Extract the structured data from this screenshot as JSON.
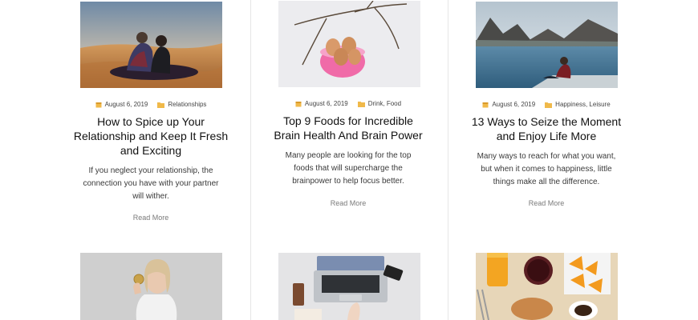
{
  "posts": [
    {
      "date": "August 6, 2019",
      "category": "Relationships",
      "title_lines": [
        "How to Spice up Your",
        "Relationship and Keep It Fresh",
        "and Exciting"
      ],
      "excerpt_lines": [
        "If you neglect your relationship, the",
        "connection you have with your partner",
        "will wither."
      ],
      "read_more": "Read More"
    },
    {
      "date": "August 6, 2019",
      "category": "Drink, Food",
      "title_lines": [
        "Top 9 Foods for Incredible",
        "Brain Health And Brain Power"
      ],
      "excerpt_lines": [
        "Many people are looking for the top",
        "foods that will supercharge the",
        "brainpower to help focus better."
      ],
      "read_more": "Read More"
    },
    {
      "date": "August 6, 2019",
      "category": "Happiness, Leisure",
      "title_lines": [
        "13 Ways to Seize the Moment",
        "and Enjoy Life More"
      ],
      "excerpt_lines": [
        "Many ways to reach for what you want,",
        "but when it comes to happiness, little",
        "things make all the difference."
      ],
      "read_more": "Read More"
    }
  ],
  "icons": {
    "date": "calendar-icon",
    "category": "folder-icon"
  },
  "colors": {
    "icon_accent": "#f0b94a",
    "title": "#111111",
    "excerpt": "#3a3a3a",
    "read_more": "#7a7a7a",
    "divider": "#e6e6e6"
  }
}
